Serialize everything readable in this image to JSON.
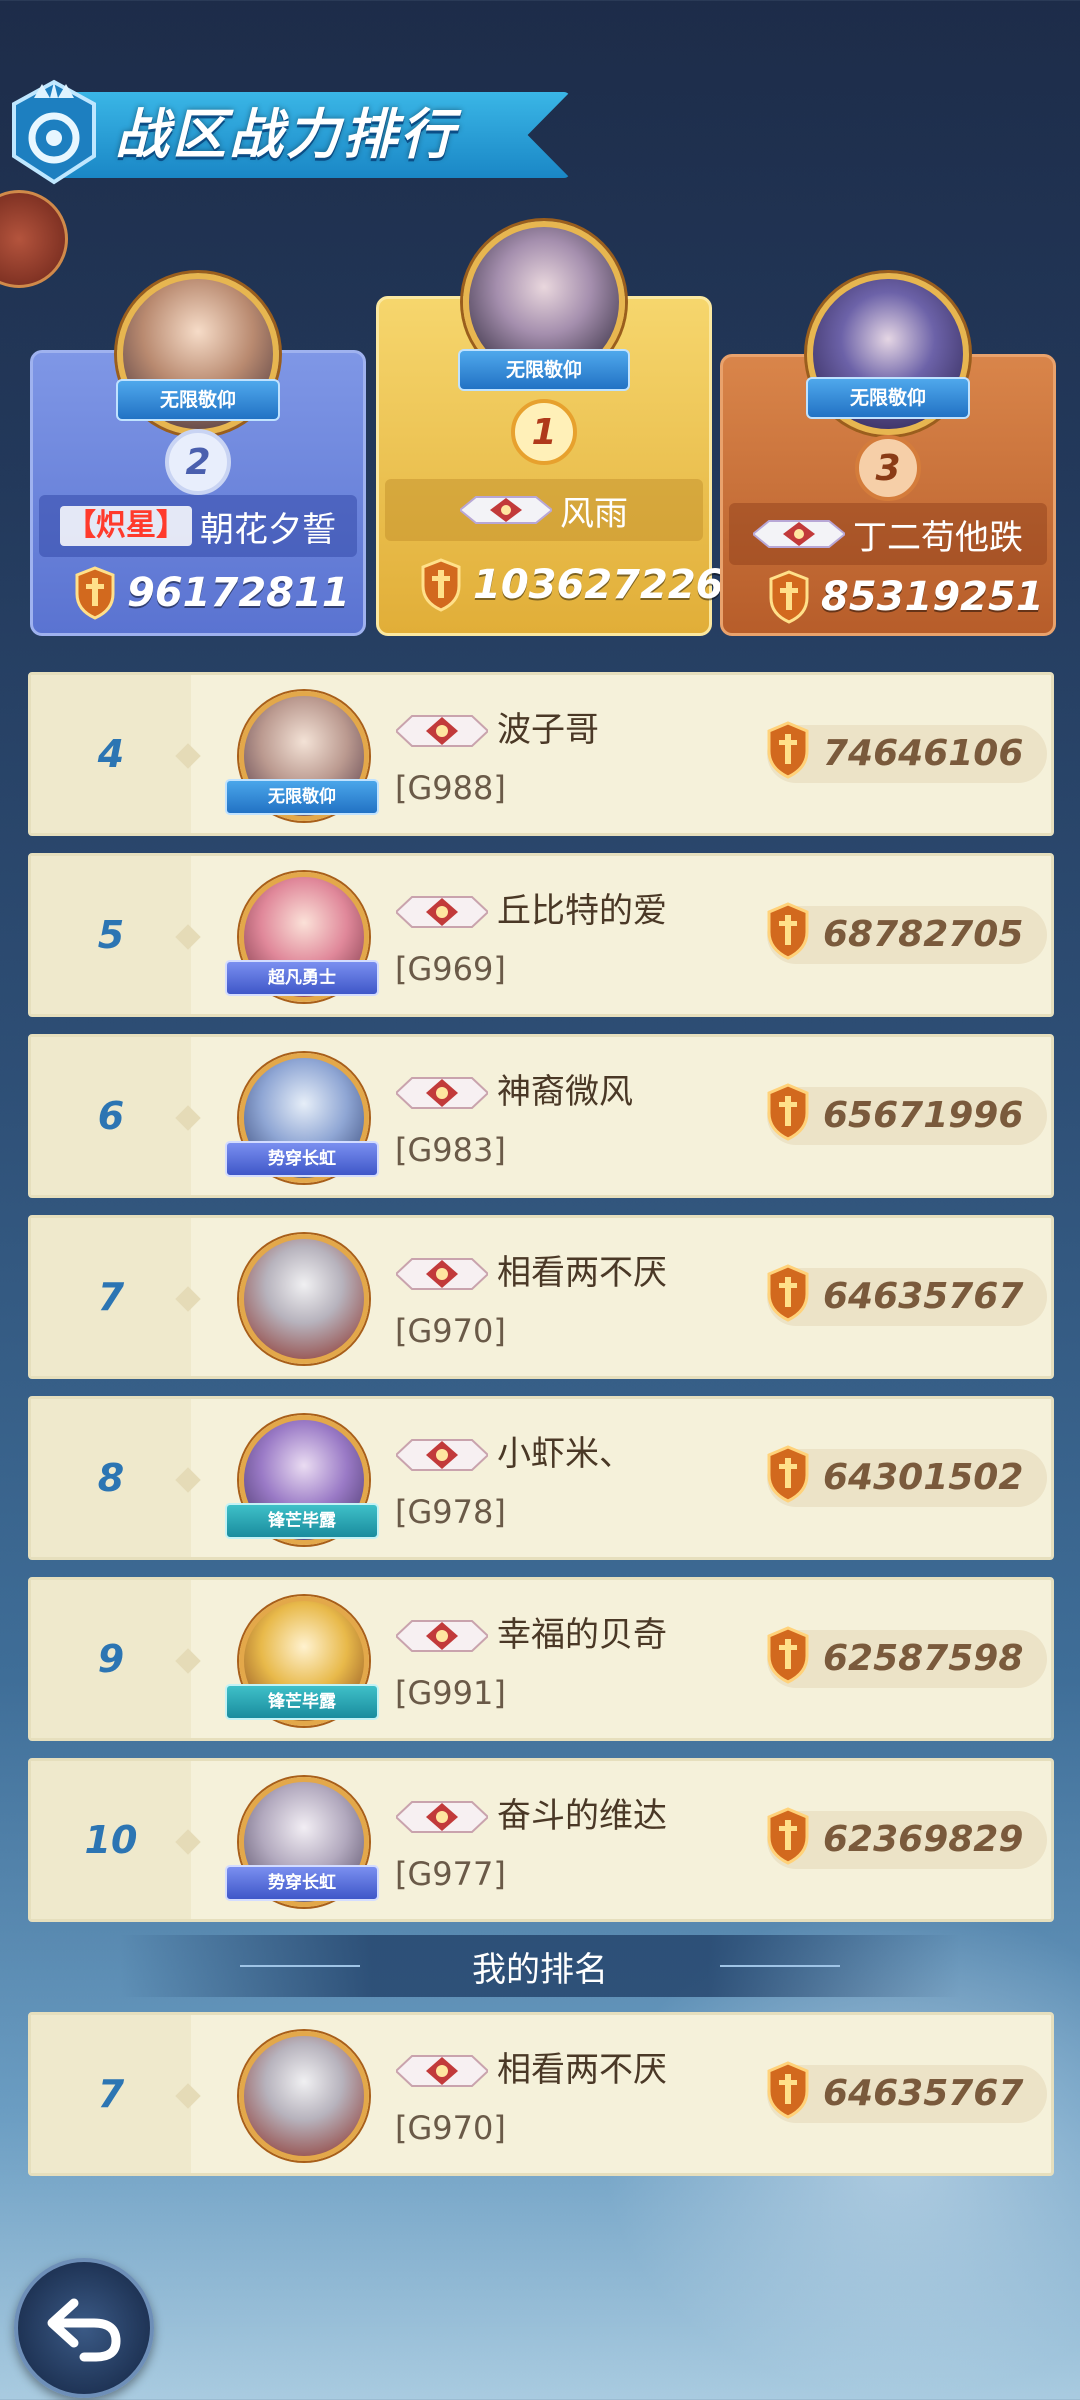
{
  "title": "战区战力排行",
  "podium": [
    {
      "rank": "2",
      "honor": "无限敬仰",
      "guild": "【炽星】",
      "name": "朝花夕誓",
      "power": "96172811"
    },
    {
      "rank": "1",
      "honor": "无限敬仰",
      "guild": "",
      "name": "风雨",
      "power": "103627226"
    },
    {
      "rank": "3",
      "honor": "无限敬仰",
      "guild": "",
      "name": "丁二苟他跌",
      "power": "85319251"
    }
  ],
  "rows": [
    {
      "rank": "4",
      "honor": "无限敬仰",
      "name": "波子哥",
      "server": "[G988]",
      "power": "74646106"
    },
    {
      "rank": "5",
      "honor": "超凡勇士",
      "name": "丘比特的爱",
      "server": "[G969]",
      "power": "68782705"
    },
    {
      "rank": "6",
      "honor": "势穿长虹",
      "name": "神裔微风",
      "server": "[G983]",
      "power": "65671996"
    },
    {
      "rank": "7",
      "honor": "",
      "name": "相看两不厌",
      "server": "[G970]",
      "power": "64635767"
    },
    {
      "rank": "8",
      "honor": "锋芒毕露",
      "name": "小虾米、",
      "server": "[G978]",
      "power": "64301502"
    },
    {
      "rank": "9",
      "honor": "锋芒毕露",
      "name": "幸福的贝奇",
      "server": "[G991]",
      "power": "62587598"
    },
    {
      "rank": "10",
      "honor": "势穿长虹",
      "name": "奋斗的维达",
      "server": "[G977]",
      "power": "62369829"
    }
  ],
  "my_rank": {
    "label": "我的排名",
    "rank": "7",
    "honor": "",
    "name": "相看两不厌",
    "server": "[G970]",
    "power": "64635767"
  },
  "icons": {
    "back": "back-arrow-icon",
    "power": "power-shield-icon",
    "emblem": "guild-emblem-icon",
    "title": "crown-emblem-icon"
  },
  "colors": {
    "rank_number": "#2c75b3",
    "row_bg": "#f5f1da",
    "gold": "#e1ae38",
    "silver_blue": "#5a73d1",
    "bronze": "#b75d2a"
  }
}
